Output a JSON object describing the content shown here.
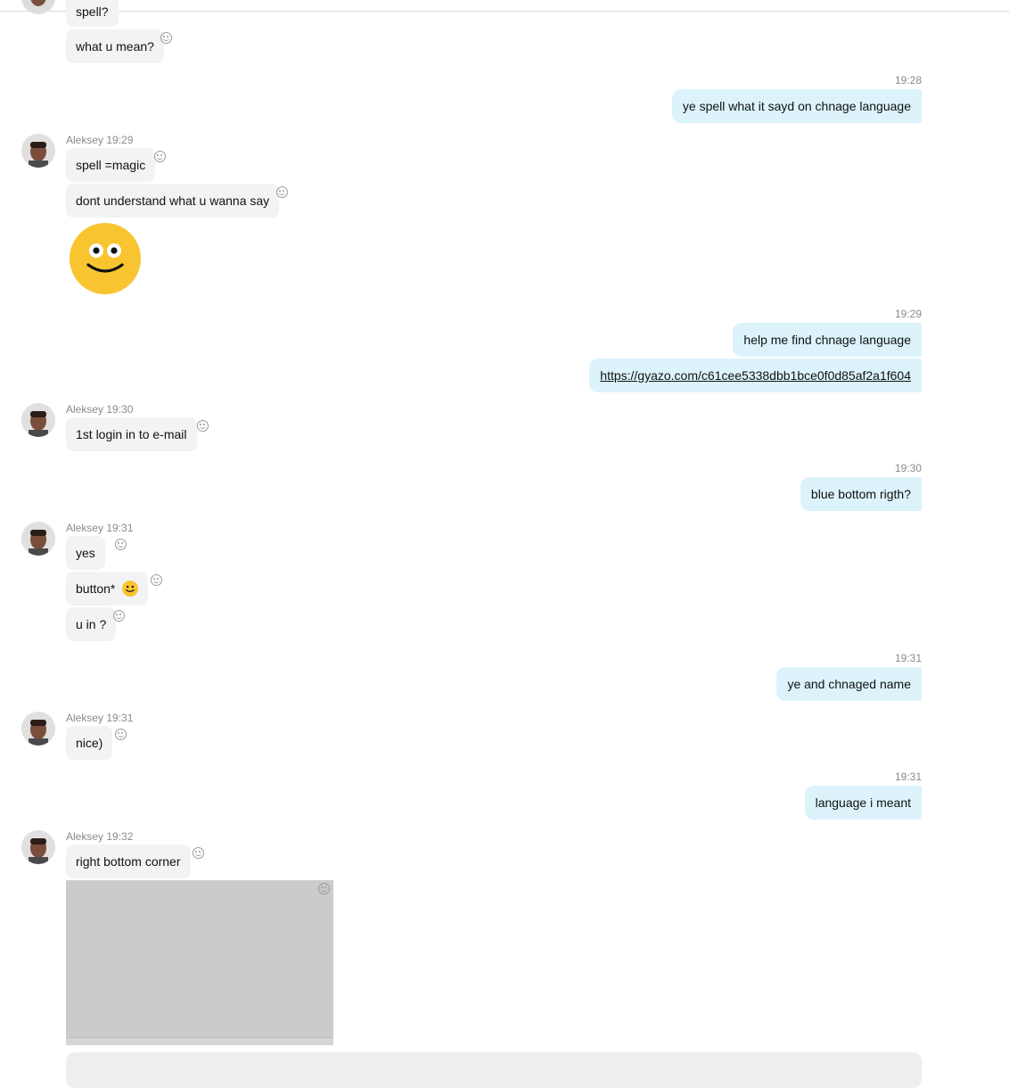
{
  "chat": {
    "partial_top": {
      "text_cut": "spell?",
      "text_mean": "what u mean?"
    },
    "msg_out_1": {
      "time": "19:28",
      "text": "ye spell what it sayd on chnage language"
    },
    "group_1": {
      "sender": "Aleksey",
      "time": "19:29",
      "messages": [
        "spell =magic",
        "dont understand what u wanna say"
      ],
      "emoji": "slightly-smiling-face"
    },
    "msg_out_2": {
      "time": "19:29",
      "text": "help me find chnage language",
      "link": "https://gyazo.com/c61cee5338dbb1bce0f0d85af2a1f604"
    },
    "group_2": {
      "sender": "Aleksey",
      "time": "19:30",
      "messages": [
        "1st login in to e-mail"
      ]
    },
    "msg_out_3": {
      "time": "19:30",
      "text": "blue bottom rigth?"
    },
    "group_3": {
      "sender": "Aleksey",
      "time": "19:31",
      "messages": [
        "yes",
        "button*",
        "u in ?"
      ]
    },
    "msg_out_4": {
      "time": "19:31",
      "text": "ye and chnaged name"
    },
    "group_4": {
      "sender": "Aleksey",
      "time": "19:31",
      "messages": [
        "nice)"
      ]
    },
    "msg_out_5": {
      "time": "19:31",
      "text": "language i meant"
    },
    "group_5": {
      "sender": "Aleksey",
      "time": "19:32",
      "messages": [
        "right bottom corner"
      ]
    }
  },
  "colors": {
    "incoming_bubble": "#f2f3f5",
    "outgoing_bubble": "#dcf3fb",
    "emoji_yellow": "#f8c530",
    "meta_text": "#8a8a8a"
  },
  "icons": {
    "reaction": "add-reaction-icon",
    "avatar": "contact-avatar"
  }
}
